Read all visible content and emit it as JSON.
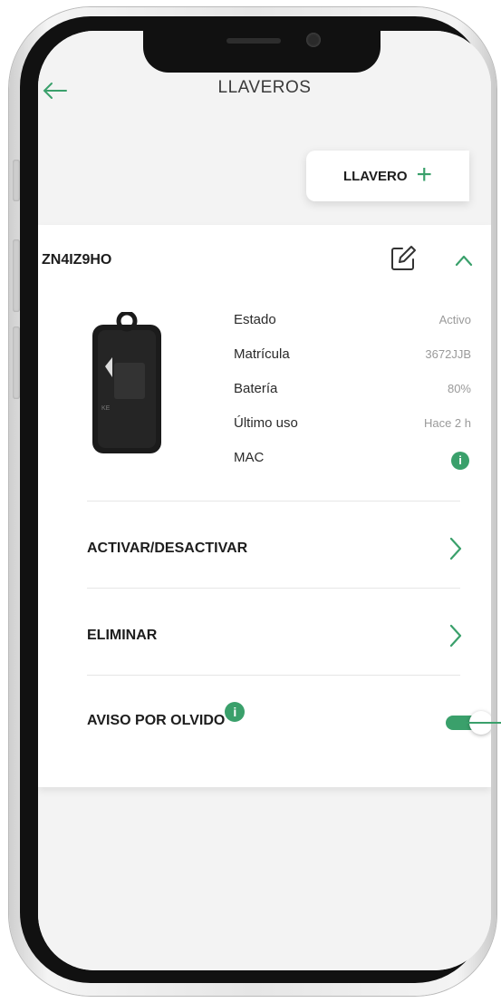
{
  "header": {
    "title": "LLAVEROS"
  },
  "add_button": {
    "label": "LLAVERO",
    "icon": "plus-icon"
  },
  "device": {
    "id": "ZN4IZ9HO",
    "info": [
      {
        "label": "Estado",
        "value": "Activo"
      },
      {
        "label": "Matrícula",
        "value": "3672JJB"
      },
      {
        "label": "Batería",
        "value": "80%"
      },
      {
        "label": "Último uso",
        "value": "Hace 2 h"
      },
      {
        "label": "MAC",
        "value": ""
      }
    ]
  },
  "actions": {
    "activate": "ACTIVAR/DESACTIVAR",
    "delete": "ELIMINAR",
    "forget_alert": "AVISO POR OLVIDO"
  },
  "info_badge": "i",
  "forget_alert_enabled": true,
  "colors": {
    "accent": "#3aa06b",
    "text": "#1d1d1d",
    "muted": "#9a9a9a"
  }
}
